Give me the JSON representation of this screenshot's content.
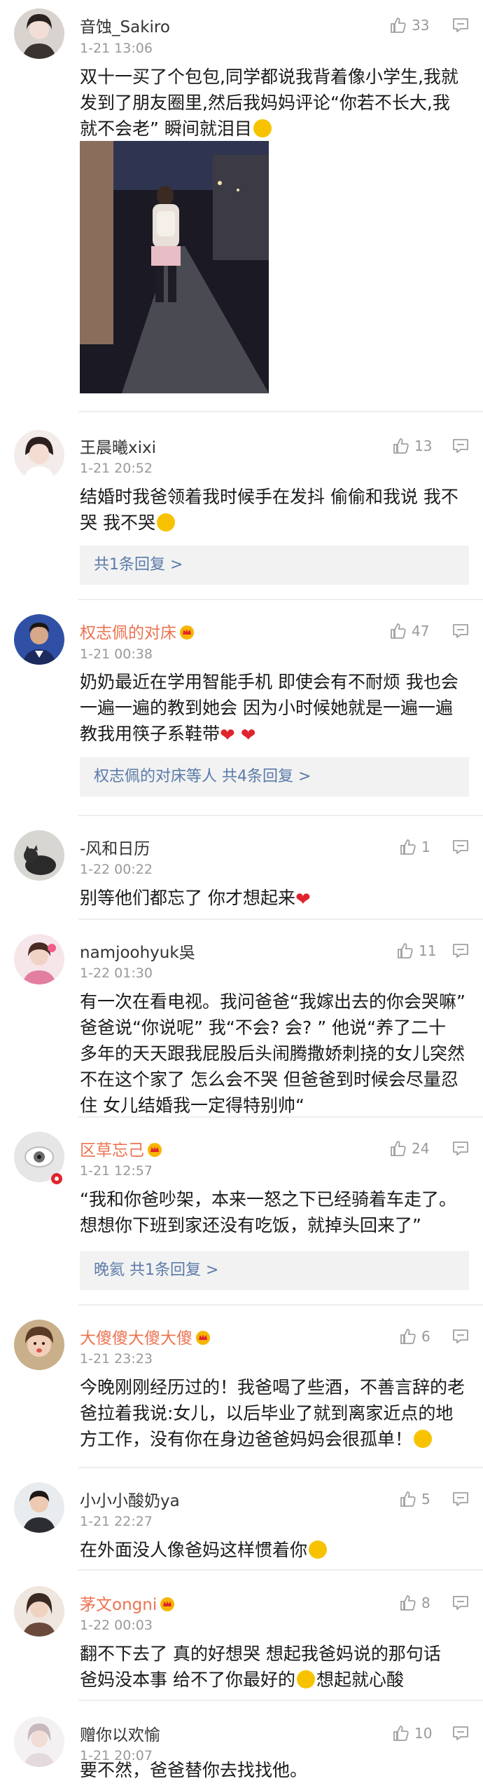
{
  "colors": {
    "accent_name": "#eb7350",
    "link": "#5a7ba9",
    "meta": "#999999",
    "divider": "#eeeeee",
    "heart": "#e0242e"
  },
  "comments": [
    {
      "username": "音蚀_Sakiro",
      "time": "1-21 13:06",
      "likes": "33",
      "text_a": "双十一买了个包包,同学都说我背着像小学生,我就\n发到了朋友圈里,然后我妈妈评论“你若不长大,我\n就不会老” 瞬间就泪目",
      "image": "photo-girl-with-backpack"
    },
    {
      "username": "王晨曦xixi",
      "time": "1-21 20:52",
      "likes": "13",
      "text_a": "结婚时我爸领着我时候手在发抖 偷偷和我说 我不\n哭 我不哭",
      "replies": "共1条回复 >"
    },
    {
      "username": "权志佩的对床",
      "time": "1-21 00:38",
      "likes": "47",
      "text_a": "奶奶最近在学用智能手机 即使会有不耐烦 我也会\n一遍一遍的教到她会 因为小时候她就是一遍一遍\n教我用筷子系鞋带",
      "replies": "权志佩的对床等人  共4条回复 >"
    },
    {
      "username": "-风和日历",
      "time": "1-22 00:22",
      "likes": "1",
      "text_a": "别等他们都忘了 你才想起来"
    },
    {
      "username": "namjoohyuk吳",
      "time": "1-22 01:30",
      "likes": "11",
      "text_a": "有一次在看电视。我问爸爸“我嫁出去的你会哭嘛”\n爸爸说“你说呢” 我“不会? 会? ” 他说“养了二十\n多年的天天跟我屁股后头闹腾撒娇刺挠的女儿突然\n不在这个家了 怎么会不哭 但爸爸到时候会尽量忍\n住 女儿结婚我一定得特别帅“"
    },
    {
      "username": "区草忘己",
      "time": "1-21 12:57",
      "likes": "24",
      "text_a": "“我和你爸吵架，本来一怒之下已经骑着车走了。\n想想你下班到家还没有吃饭，就掉头回来了”",
      "replies": "晚氦  共1条回复 >"
    },
    {
      "username": "大傻傻大傻大傻",
      "time": "1-21 23:23",
      "likes": "6",
      "text_a": "今晚刚刚经历过的！我爸喝了些酒，不善言辞的老\n爸拉着我说:女儿，以后毕业了就到离家近点的地\n方工作，没有你在身边爸爸妈妈会很孤单！"
    },
    {
      "username": "小小小酸奶ya",
      "time": "1-21 22:27",
      "likes": "5",
      "text_a": "在外面没人像爸妈这样惯着你"
    },
    {
      "username": "茅文ongni",
      "time": "1-22 00:03",
      "likes": "8",
      "text_a": "翻不下去了 真的好想哭  想起我爸妈说的那句话\n爸妈没本事 给不了你最好的",
      "text_b": "想起就心酸"
    },
    {
      "username": "赠你以欢愉",
      "time": "1-21 20:07",
      "likes": "10",
      "text_a": "要不然，爸爸替你去找找他。"
    }
  ]
}
